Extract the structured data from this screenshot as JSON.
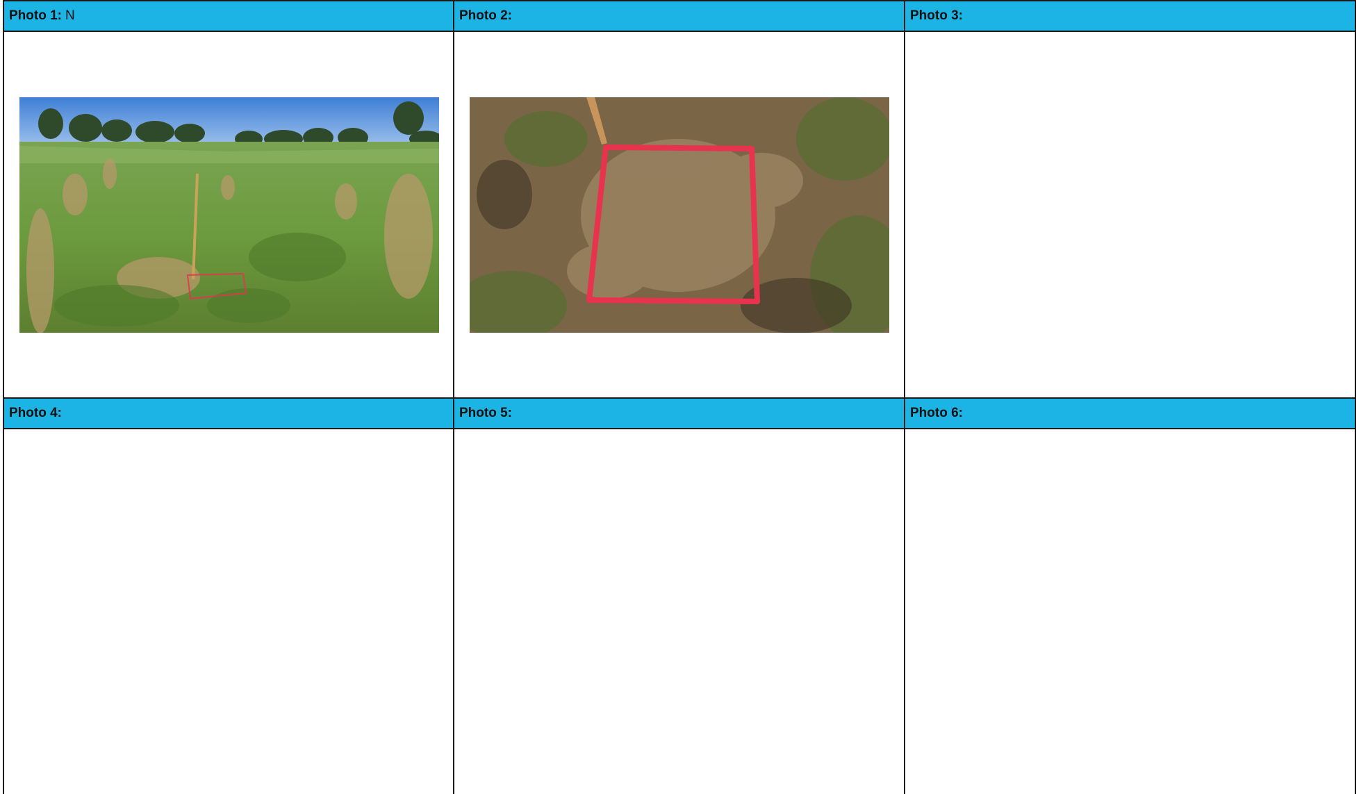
{
  "photos": [
    {
      "label": "Photo 1:",
      "note": "N",
      "has_image": true
    },
    {
      "label": "Photo 2:",
      "note": "",
      "has_image": true
    },
    {
      "label": "Photo 3:",
      "note": "",
      "has_image": false
    },
    {
      "label": "Photo 4:",
      "note": "",
      "has_image": false
    },
    {
      "label": "Photo 5:",
      "note": "",
      "has_image": false
    },
    {
      "label": "Photo 6:",
      "note": "",
      "has_image": false
    }
  ],
  "colors": {
    "header": "#1bb4e4",
    "border": "#1b1b1b",
    "quadrat_paint": "#e8334f"
  }
}
